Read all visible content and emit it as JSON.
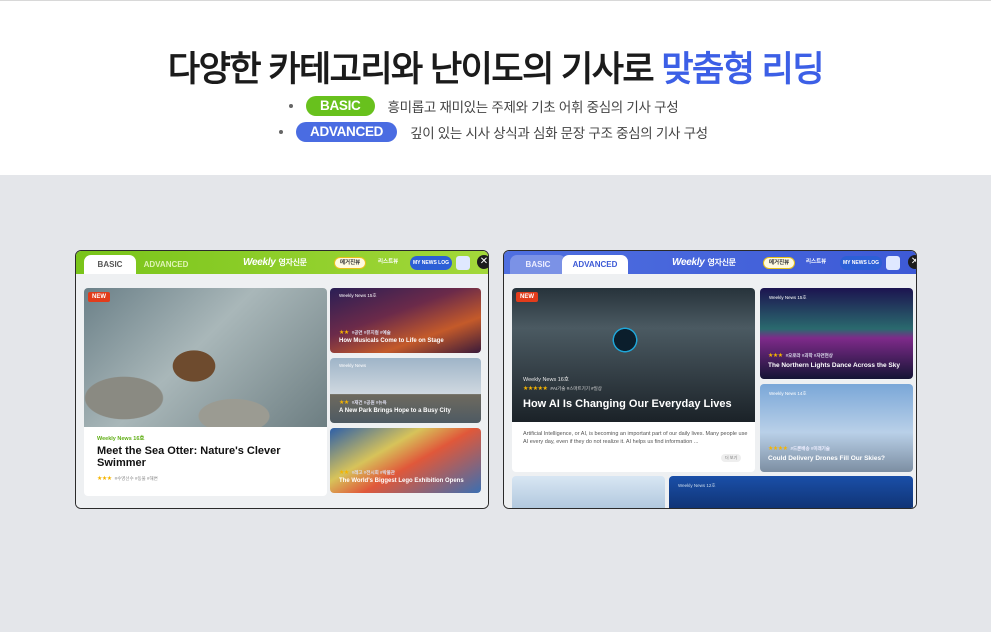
{
  "hero": {
    "headline_main": "다양한 카테고리와 난이도의 기사로",
    "headline_highlight": "맞춤형 리딩",
    "rows": [
      {
        "pill": "BASIC",
        "desc": "흥미롭고 재미있는 주제와 기초 어휘 중심의 기사 구성"
      },
      {
        "pill": "ADVANCED",
        "desc": "깊이 있는 시사 상식과 심화 문장 구조 중심의 기사 구성"
      }
    ]
  },
  "colors": {
    "basic": "#68c11d",
    "advanced": "#4a6ce2",
    "highlight": "#3c5fe6"
  },
  "windows": [
    {
      "tabs": [
        "BASIC",
        "ADVANCED"
      ],
      "active_tab": "BASIC",
      "brand": "Weekly",
      "brand_ko": "영자신문",
      "pills": [
        "메거진뷰",
        "리스트뷰"
      ],
      "newslog": "MY NEWS LOG",
      "featured": {
        "badge": "NEW",
        "issue": "Weekly News 16호",
        "title": "Meet the Sea Otter: Nature's Clever Swimmer",
        "tags": "#수영선수 #동물 #해변"
      },
      "cards": [
        {
          "issue": "Weekly News 15호",
          "tags": "#공연 #뮤지컬 #예술",
          "title": "How Musicals Come to Life on Stage"
        },
        {
          "issue": "Weekly News",
          "tags": "#재건 #공원 #뉴욕",
          "title": "A New Park Brings Hope to a Busy City"
        },
        {
          "issue": "",
          "tags": "#레고 #전시회 #박물관",
          "title": "The World's Biggest Lego Exhibition Opens"
        }
      ]
    },
    {
      "tabs": [
        "BASIC",
        "ADVANCED"
      ],
      "active_tab": "ADVANCED",
      "brand": "Weekly",
      "brand_ko": "영자신문",
      "pills": [
        "메거진뷰",
        "리스트뷰"
      ],
      "newslog": "MY NEWS LOG",
      "featured": {
        "badge": "NEW",
        "issue": "Weekly News 16호",
        "tags": "#AI기술 #스마트기기 #일상",
        "title": "How AI Is Changing Our Everyday Lives",
        "body": "Artificial Intelligence, or AI, is becoming an important part of our daily lives. Many people use AI every day, even if they do not realize it. AI helps us find information ...",
        "more": "더 보기"
      },
      "cards": [
        {
          "issue": "Weekly News 15호",
          "tags": "#오로라 #과학 #자연현상",
          "title": "The Northern Lights Dance Across the Sky"
        },
        {
          "issue": "Weekly News 14호",
          "tags": "#드론배송 #미래기술",
          "title": "Could Delivery Drones Fill Our Skies?"
        },
        {
          "issue": "",
          "tags": "",
          "title": ""
        },
        {
          "issue": "Weekly News 12호",
          "tags": "",
          "title": ""
        }
      ]
    }
  ]
}
